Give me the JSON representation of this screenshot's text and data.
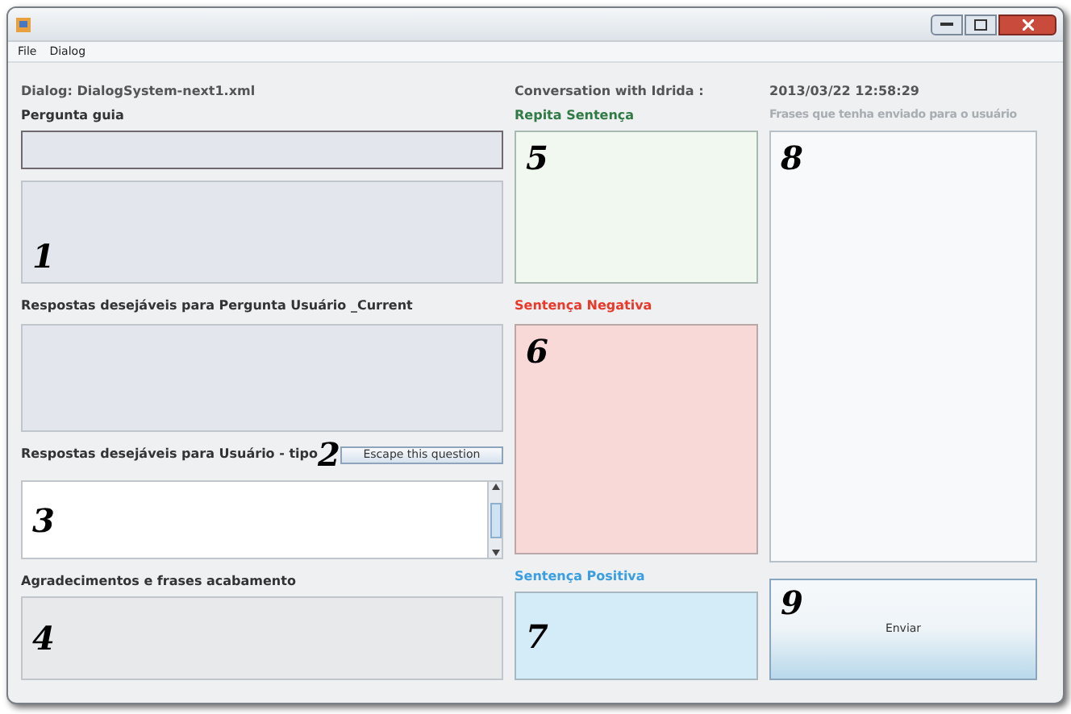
{
  "menu": [
    "File",
    "Dialog"
  ],
  "left": {
    "dialog_label": "Dialog: DialogSystem-next1.xml",
    "question_label": "Pergunta guia",
    "question_mark": "1",
    "answers_label": "Respostas desejáveis para Pergunta Usuário _Current",
    "user_label": "Respostas desejáveis para Usuário - tipo",
    "user_mark": "2",
    "escape_button": "Escape this question",
    "list_mark": "3",
    "thanks_label": "Agradecimentos e frases acabamento",
    "thanks_mark": "4"
  },
  "middle": {
    "title": "Conversation with Idrida :",
    "repeat_label": "Repita Sentença",
    "repeat_mark": "5",
    "negative_label": "Sentença Negativa",
    "negative_mark": "6",
    "positive_label": "Sentença Positiva",
    "positive_mark": "7"
  },
  "right": {
    "timestamp": "2013/03/22 12:58:29",
    "sent_label": "Frases que tenha enviado para o usuário",
    "sent_mark": "8",
    "send_mark": "9",
    "send_button": "Enviar"
  }
}
